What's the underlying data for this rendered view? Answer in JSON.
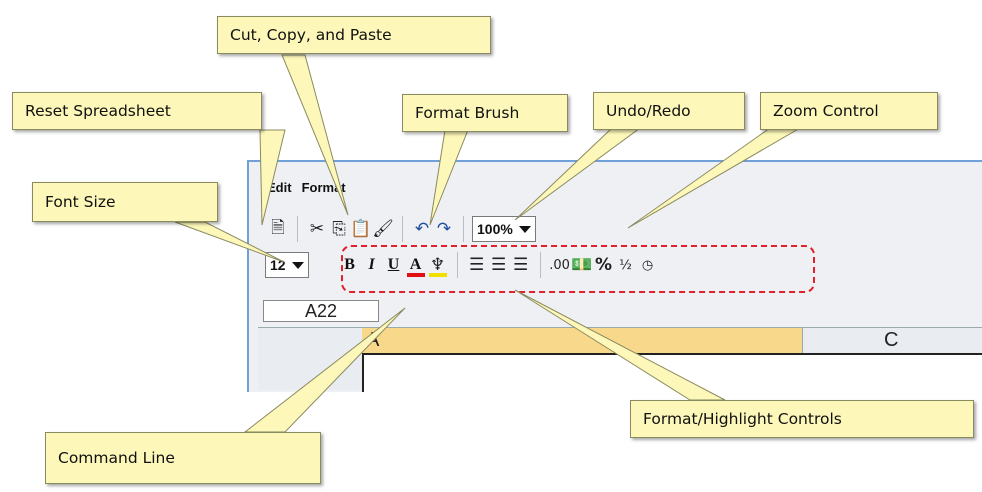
{
  "menu": {
    "edit": "Edit",
    "format": "Format"
  },
  "toolbar": {
    "zoom_value": "100%",
    "font_size_value": "12",
    "bold": "B",
    "italic": "I",
    "underline": "U",
    "font_color": "A",
    "decimal": ".00",
    "percent": "%",
    "fraction": "½"
  },
  "sheet": {
    "cell_reference": "A22",
    "column_a": "A",
    "column_c": "C"
  },
  "callouts": {
    "cut_copy_paste": "Cut, Copy, and Paste",
    "reset_spreadsheet": "Reset Spreadsheet",
    "format_brush": "Format Brush",
    "undo_redo": "Undo/Redo",
    "zoom_control": "Zoom Control",
    "font_size": "Font Size",
    "format_highlight": "Format/Highlight Controls",
    "command_line": "Command Line"
  },
  "colors": {
    "callout_bg": "#fdf8b9",
    "highlight_box": "#e0202a",
    "window_border": "#6fa0d8",
    "selected_column": "#f8d98b"
  }
}
